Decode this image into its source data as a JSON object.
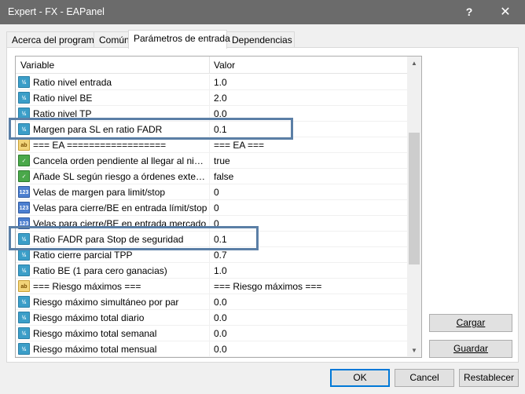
{
  "window": {
    "title": "Expert - FX - EAPanel",
    "help_glyph": "?",
    "close_glyph": "✕"
  },
  "tabs": [
    {
      "label": "Acerca del programa"
    },
    {
      "label": "Común"
    },
    {
      "label": "Parámetros de entrada"
    },
    {
      "label": "Dependencias"
    }
  ],
  "grid": {
    "headers": {
      "variable": "Variable",
      "value": "Valor"
    },
    "rows": [
      {
        "icon": "real",
        "icon_text": "½",
        "name": "Ratio nivel entrada",
        "value": "1.0"
      },
      {
        "icon": "real",
        "icon_text": "½",
        "name": "Ratio nivel BE",
        "value": "2.0"
      },
      {
        "icon": "real",
        "icon_text": "½",
        "name": "Ratio nivel TP",
        "value": "0.0"
      },
      {
        "icon": "real",
        "icon_text": "½",
        "name": "Margen para SL en ratio FADR",
        "value": "0.1"
      },
      {
        "icon": "str",
        "icon_text": "ab",
        "name": "=== EA  ==================",
        "value": "=== EA  ==="
      },
      {
        "icon": "bool",
        "icon_text": "✓",
        "name": "Cancela orden pendiente al llegar al nivel BE...",
        "value": "true"
      },
      {
        "icon": "bool",
        "icon_text": "✓",
        "name": "Añade SL según riesgo a órdenes externas",
        "value": "false"
      },
      {
        "icon": "int",
        "icon_text": "123",
        "name": "Velas de margen para limit/stop",
        "value": "0"
      },
      {
        "icon": "int",
        "icon_text": "123",
        "name": "Velas para cierre/BE en entrada límit/stop",
        "value": "0"
      },
      {
        "icon": "int",
        "icon_text": "123",
        "name": "Velas para cierre/BE en entrada mercado",
        "value": "0"
      },
      {
        "icon": "real",
        "icon_text": "½",
        "name": "Ratio FADR para Stop de seguridad",
        "value": "0.1"
      },
      {
        "icon": "real",
        "icon_text": "½",
        "name": "Ratio cierre parcial TPP",
        "value": "0.7"
      },
      {
        "icon": "real",
        "icon_text": "½",
        "name": "Ratio BE (1 para cero ganacias)",
        "value": "1.0"
      },
      {
        "icon": "str",
        "icon_text": "ab",
        "name": "=== Riesgo máximos ===",
        "value": "=== Riesgo máximos ==="
      },
      {
        "icon": "real",
        "icon_text": "½",
        "name": "Riesgo máximo simultáneo por par",
        "value": "0.0"
      },
      {
        "icon": "real",
        "icon_text": "½",
        "name": "Riesgo máximo total diario",
        "value": "0.0"
      },
      {
        "icon": "real",
        "icon_text": "½",
        "name": "Riesgo máximo total semanal",
        "value": "0.0"
      },
      {
        "icon": "real",
        "icon_text": "½",
        "name": "Riesgo máximo total mensual",
        "value": "0.0"
      }
    ],
    "scroll_up_glyph": "▲",
    "scroll_down_glyph": "▼"
  },
  "side_buttons": {
    "load": "Cargar",
    "save": "Guardar"
  },
  "footer_buttons": {
    "ok": "OK",
    "cancel": "Cancel",
    "reset": "Restablecer"
  },
  "colors": {
    "highlight": "#5b7fa6",
    "titlebar": "#6b6b6b",
    "default_button_border": "#0078d7"
  }
}
